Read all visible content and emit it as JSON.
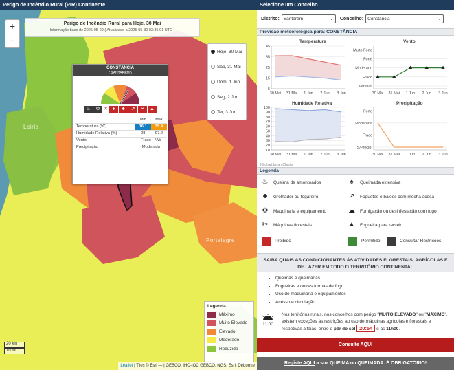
{
  "map_panel": {
    "header": "Perigo de Incêndio Rural (PIR) Continente",
    "title": "Perigo de Incêndio Rural para Hoje, 30 Mai",
    "subtitle": "Informação base de 2025-05-29  ( Atualizado a 2025-05-30 03:35:01 UTC )",
    "zoom_in": "+",
    "zoom_out": "−",
    "places": [
      "Leiria",
      "Portalegre"
    ],
    "days": [
      {
        "label": "Hoje, 30 Mai",
        "selected": true
      },
      {
        "label": "Sáb, 31 Mai",
        "selected": false
      },
      {
        "label": "Dom, 1 Jun",
        "selected": false
      },
      {
        "label": "Seg, 2 Jun",
        "selected": false
      },
      {
        "label": "Ter, 3 Jun",
        "selected": false
      }
    ],
    "popup": {
      "municipality": "CONSTÂNCIA",
      "district": "( SANTARÉM )",
      "col_min": "Min",
      "col_max": "Max",
      "rows": [
        {
          "label": "Temperatura (ºC)",
          "min": "16.1",
          "max": "35.9"
        },
        {
          "label": "Humidade Relativa (%)",
          "min": "28",
          "max": "97.2"
        },
        {
          "label": "Vento",
          "value": "Fraco - NW"
        },
        {
          "label": "Precipitação",
          "value": "Moderada"
        }
      ]
    },
    "legend": {
      "title": "Legenda",
      "items": [
        {
          "label": "Máximo",
          "color": "#8e2c4a"
        },
        {
          "label": "Muito Elevado",
          "color": "#d0535d"
        },
        {
          "label": "Elevado",
          "color": "#f08a3a"
        },
        {
          "label": "Moderado",
          "color": "#f6e94a"
        },
        {
          "label": "Reduzido",
          "color": "#8ec540"
        }
      ]
    },
    "scale": {
      "km": "20 km",
      "mi": "10 mi"
    },
    "attribution_link": "Leaflet",
    "attribution": " | Tiles © Esri — | GEBCO, IHO-IOC GEBCO, NGS, Esri, DeLorme"
  },
  "side": {
    "header": "Selecione um Concelho",
    "district_label": "Distrito:",
    "district_value": "Santarém",
    "council_label": "Concelho:",
    "council_value": "Constância",
    "forecast_title": "Previsão meteorológica para: CONSTÂNCIA",
    "charts": {
      "temperatura": "Temperatura",
      "vento": "Vento",
      "humidade": "Humidade Relativa",
      "precipitacao": "Precipitação",
      "credit": "JS chart by amCharts"
    },
    "legend_title": "Legenda",
    "legend": {
      "queima": "Queima de amontoados",
      "queimada": "Queimada extensiva",
      "grelhador": "Grelhador ou fogareiro",
      "foguetes": "Foguetes e balões com mecha acesa",
      "maquinaria": "Maquinaria e equipamento",
      "fumigacao": "Fumigação ou desinfestação com fogo",
      "maquinas": "Máquinas florestais",
      "fogueira": "Fogueira para recreio",
      "proibido": "Proibido",
      "permitido": "Permitido",
      "consultar": "Consultar Restrições"
    },
    "conditions_title": "SAIBA QUAIS AS CONDICIONANTES ÀS ATIVIDADES FLORESTAIS, AGRÍCOLAS E DE LAZER EM TODO O TERRITÓRIO CONTINENTAL",
    "conditions": [
      "Queimas e queimadas",
      "Fogueiras e outras formas de fogo",
      "Uso de maquinaria e equipamentos",
      "Acesso e circulação"
    ],
    "sun_time_label": "11:00",
    "sun_text_1": "Nos territórios rurais, nos concelhos com perigo \"",
    "sun_bold_1": "MUITO ELEVADO",
    "sun_text_2": "\" ou \"",
    "sun_bold_2": "MÁXIMO",
    "sun_text_3": "\", existem exceções às restrições ao uso de máquinas agrícolas e florestais e respetivas alfaias, entre o",
    "sun_bold_3": "pôr do sol",
    "sunset_time": "20:54",
    "sun_text_4": "e as",
    "sun_bold_4": "11h00",
    "consult_button": "Consulte AQUI",
    "register_link": "Registe AQUI",
    "register_text": "a sua QUEIMA ou QUEIMADA. É OBRIGATÓRIO!"
  },
  "chart_data": [
    {
      "type": "line",
      "title": "Temperatura",
      "categories": [
        "30 Mai",
        "31 Mai",
        "1 Jun",
        "2 Jun",
        "3 Jun"
      ],
      "ylim": [
        5,
        45
      ],
      "series": [
        {
          "values": [
            35.9,
            36,
            33,
            30,
            27
          ],
          "color": "#e57373"
        },
        {
          "values": [
            16.1,
            17,
            16,
            15,
            13
          ],
          "color": "#9fb8e6"
        }
      ]
    },
    {
      "type": "line",
      "title": "Vento",
      "categories": [
        "30 Mai",
        "31 Mai",
        "1 Jun",
        "2 Jun",
        "3 Jun"
      ],
      "ycategories": [
        "Variável",
        "Fraco",
        "Moderado",
        "Forte",
        "Muito Forte"
      ],
      "series": [
        {
          "values": [
            1,
            1,
            2,
            2,
            2
          ],
          "color": "#2e7d32"
        }
      ]
    },
    {
      "type": "area",
      "title": "Humidade Relativa",
      "categories": [
        "30 Mai",
        "31 Mai",
        "1 Jun",
        "2 Jun",
        "3 Jun"
      ],
      "ylim": [
        10,
        100
      ],
      "series": [
        {
          "values": [
            97.2,
            95,
            93,
            95,
            90
          ],
          "color": "#8fa8e0"
        },
        {
          "values": [
            28,
            27,
            32,
            33,
            37
          ],
          "color": "#bbbbbb"
        }
      ]
    },
    {
      "type": "line",
      "title": "Precipitação",
      "categories": [
        "30 Mai",
        "31 Mai",
        "1 Jun",
        "2 Jun",
        "3 Jun"
      ],
      "ycategories": [
        "S/Precip.",
        "Fraco",
        "Moderada",
        "Forte"
      ],
      "series": [
        {
          "values": [
            2,
            0,
            0,
            0,
            0
          ],
          "color": "#f4a460"
        }
      ]
    }
  ]
}
